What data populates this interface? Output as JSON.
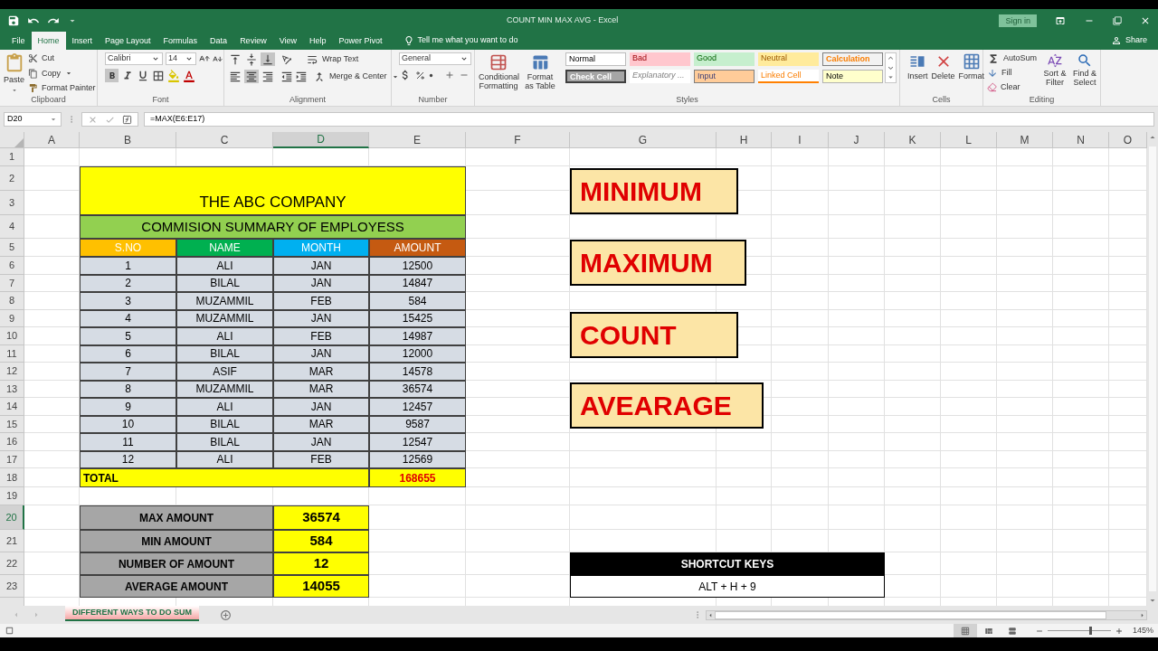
{
  "title_bar": {
    "title": "COUNT MIN MAX AVG  -  Excel",
    "sign_in": "Sign in"
  },
  "menu_tabs": [
    {
      "label": "File",
      "selected": false
    },
    {
      "label": "Home",
      "selected": true
    },
    {
      "label": "Insert",
      "selected": false
    },
    {
      "label": "Page Layout",
      "selected": false
    },
    {
      "label": "Formulas",
      "selected": false
    },
    {
      "label": "Data",
      "selected": false
    },
    {
      "label": "Review",
      "selected": false
    },
    {
      "label": "View",
      "selected": false
    },
    {
      "label": "Help",
      "selected": false
    },
    {
      "label": "Power Pivot",
      "selected": false
    }
  ],
  "tell_me": "Tell me what you want to do",
  "share": "Share",
  "ribbon": {
    "clipboard": {
      "paste": "Paste",
      "cut": "Cut",
      "copy": "Copy",
      "format_painter": "Format Painter",
      "label": "Clipboard"
    },
    "font": {
      "name": "Calibri",
      "size": "14",
      "bold": true,
      "label": "Font"
    },
    "alignment": {
      "vertical": [
        {
          "kind": "top",
          "selected": false
        },
        {
          "kind": "middle",
          "selected": false
        },
        {
          "kind": "bottom",
          "selected": true
        }
      ],
      "horizontal": [
        {
          "kind": "left",
          "selected": false
        },
        {
          "kind": "center",
          "selected": true
        },
        {
          "kind": "right",
          "selected": false
        }
      ],
      "wrap_text": "Wrap Text",
      "merge": "Merge & Center",
      "label": "Alignment"
    },
    "number": {
      "format": "General",
      "label": "Number"
    },
    "styles": {
      "conditional": "Conditional Formatting",
      "format_table": "Format as Table",
      "label": "Styles",
      "cell_styles": [
        {
          "label": "Normal",
          "kind": "normal"
        },
        {
          "label": "Check Cell",
          "kind": "check"
        },
        {
          "label": "Bad",
          "kind": "bad"
        },
        {
          "label": "Explanatory ...",
          "kind": "explanatory"
        },
        {
          "label": "Good",
          "kind": "good"
        },
        {
          "label": "Input",
          "kind": "input"
        },
        {
          "label": "Neutral",
          "kind": "neutral"
        },
        {
          "label": "Linked Cell",
          "kind": "linked"
        },
        {
          "label": "Calculation",
          "kind": "calculation"
        },
        {
          "label": "Note",
          "kind": "note"
        }
      ]
    },
    "cells": {
      "insert": "Insert",
      "delete": "Delete",
      "format": "Format",
      "label": "Cells"
    },
    "editing": {
      "autosum": "AutoSum",
      "fill": "Fill",
      "clear": "Clear",
      "sort": "Sort & Filter",
      "find": "Find & Select",
      "label": "Editing"
    }
  },
  "formula_bar": {
    "name_box": "D20",
    "formula": "=MAX(E6:E17)"
  },
  "sheet": {
    "columns": [
      {
        "label": "A",
        "selected": false
      },
      {
        "label": "B",
        "selected": false
      },
      {
        "label": "C",
        "selected": false
      },
      {
        "label": "D",
        "selected": true
      },
      {
        "label": "E",
        "selected": false
      },
      {
        "label": "F",
        "selected": false
      },
      {
        "label": "G",
        "selected": false
      },
      {
        "label": "H",
        "selected": false
      },
      {
        "label": "I",
        "selected": false
      },
      {
        "label": "J",
        "selected": false
      },
      {
        "label": "K",
        "selected": false
      },
      {
        "label": "L",
        "selected": false
      },
      {
        "label": "M",
        "selected": false
      },
      {
        "label": "N",
        "selected": false
      },
      {
        "label": "O",
        "selected": false
      }
    ],
    "rows": [
      {
        "label": "1",
        "selected": false
      },
      {
        "label": "2",
        "selected": false
      },
      {
        "label": "3",
        "selected": false
      },
      {
        "label": "4",
        "selected": false
      },
      {
        "label": "5",
        "selected": false
      },
      {
        "label": "6",
        "selected": false
      },
      {
        "label": "7",
        "selected": false
      },
      {
        "label": "8",
        "selected": false
      },
      {
        "label": "9",
        "selected": false
      },
      {
        "label": "10",
        "selected": false
      },
      {
        "label": "11",
        "selected": false
      },
      {
        "label": "12",
        "selected": false
      },
      {
        "label": "13",
        "selected": false
      },
      {
        "label": "14",
        "selected": false
      },
      {
        "label": "15",
        "selected": false
      },
      {
        "label": "16",
        "selected": false
      },
      {
        "label": "17",
        "selected": false
      },
      {
        "label": "18",
        "selected": false
      },
      {
        "label": "19",
        "selected": false
      },
      {
        "label": "20",
        "selected": true
      },
      {
        "label": "21",
        "selected": false
      },
      {
        "label": "22",
        "selected": false
      },
      {
        "label": "23",
        "selected": false
      }
    ],
    "title": "THE ABC COMPANY",
    "subtitle": "COMMISION SUMMARY OF EMPLOYESS",
    "table": {
      "columns": [
        {
          "label": "S.NO",
          "color": "#ffc000"
        },
        {
          "label": "NAME",
          "color": "#00b050"
        },
        {
          "label": "MONTH",
          "color": "#00b0f0"
        },
        {
          "label": "AMOUNT",
          "color": "#c55a11"
        }
      ],
      "rows": [
        [
          "1",
          "ALI",
          "JAN",
          "12500"
        ],
        [
          "2",
          "BILAL",
          "JAN",
          "14847"
        ],
        [
          "3",
          "MUZAMMIL",
          "FEB",
          "584"
        ],
        [
          "4",
          "MUZAMMIL",
          "JAN",
          "15425"
        ],
        [
          "5",
          "ALI",
          "FEB",
          "14987"
        ],
        [
          "6",
          "BILAL",
          "JAN",
          "12000"
        ],
        [
          "7",
          "ASIF",
          "MAR",
          "14578"
        ],
        [
          "8",
          "MUZAMMIL",
          "MAR",
          "36574"
        ],
        [
          "9",
          "ALI",
          "JAN",
          "12457"
        ],
        [
          "10",
          "BILAL",
          "MAR",
          "9587"
        ],
        [
          "11",
          "BILAL",
          "JAN",
          "12547"
        ],
        [
          "12",
          "ALI",
          "FEB",
          "12569"
        ]
      ],
      "total": {
        "label": "TOTAL",
        "value": "168655"
      }
    },
    "summary": [
      {
        "label": "MAX AMOUNT",
        "value": "36574"
      },
      {
        "label": "MIN AMOUNT",
        "value": "584"
      },
      {
        "label": "NUMBER OF AMOUNT",
        "value": "12"
      },
      {
        "label": "AVERAGE AMOUNT",
        "value": "14055"
      }
    ],
    "shapes": [
      {
        "label": "MINIMUM"
      },
      {
        "label": "MAXIMUM"
      },
      {
        "label": "COUNT"
      },
      {
        "label": "AVEARAGE"
      }
    ],
    "shortcut": {
      "title": "SHORTCUT KEYS",
      "keys": "ALT + H + 9"
    }
  },
  "sheet_tabs": [
    {
      "label": "DIFFERENT WAYS TO DO SUM",
      "selected": true
    }
  ],
  "status_bar": {
    "views": [
      {
        "kind": "normal",
        "selected": true
      },
      {
        "kind": "page_layout",
        "selected": false
      },
      {
        "kind": "page_break",
        "selected": false
      }
    ],
    "zoom_slider": {
      "level": 0.67
    },
    "zoom": "145%"
  }
}
